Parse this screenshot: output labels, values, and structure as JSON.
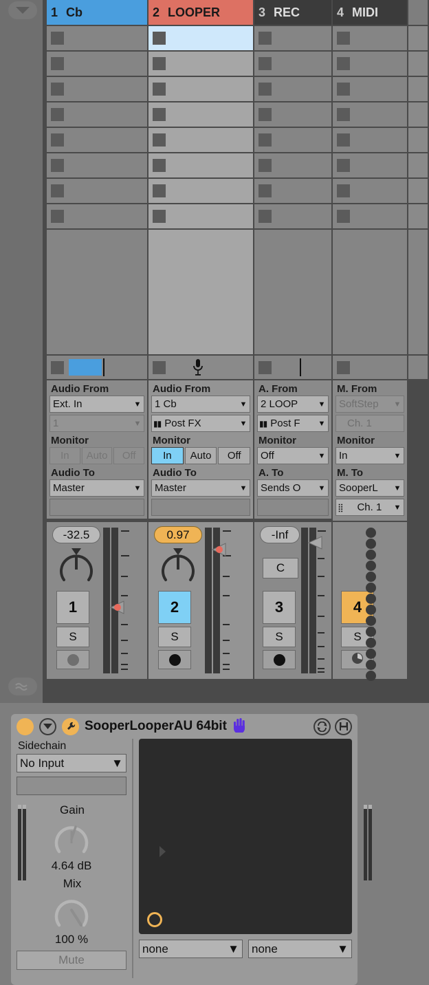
{
  "app": {
    "window_bg": "#7e7e7e",
    "accent_blue": "#4a9ede",
    "accent_amber": "#f0b455",
    "accent_red": "#dd7163"
  },
  "rail": {
    "top_icon": "chevron-down-icon",
    "bottom_icon": "waveform-icon"
  },
  "tracks": [
    {
      "num": "1",
      "name": "Cb",
      "header_color": "blue",
      "audio_from_label": "Audio From",
      "input_type": "Ext. In",
      "input_channel": "1",
      "input_channel_dim": true,
      "monitor_label": "Monitor",
      "monitor_buttons": [
        {
          "label": "In",
          "state": "off"
        },
        {
          "label": "Auto",
          "state": "off"
        },
        {
          "label": "Off",
          "state": "off"
        }
      ],
      "audio_to_label": "Audio To",
      "output": "Master",
      "output_channel": "",
      "volume": "-32.5",
      "volume_style": "plain",
      "track_button": "1",
      "solo": "S",
      "arm_active": false,
      "has_bluebar": true,
      "has_playcursor": true,
      "has_mic": false,
      "pan_indicator": true
    },
    {
      "num": "2",
      "name": "LOOPER",
      "header_color": "red",
      "audio_from_label": "Audio From",
      "input_type": "1   Cb",
      "input_channel": "Post FX",
      "input_channel_dim": false,
      "monitor_label": "Monitor",
      "monitor_buttons": [
        {
          "label": "In",
          "state": "active"
        },
        {
          "label": "Auto",
          "state": "on"
        },
        {
          "label": "Off",
          "state": "on"
        }
      ],
      "audio_to_label": "Audio To",
      "output": "Master",
      "output_channel": "",
      "volume": "0.97",
      "volume_style": "amber",
      "track_button": "2",
      "solo": "S",
      "arm_active": true,
      "has_bluebar": false,
      "has_playcursor": false,
      "has_mic": true,
      "pan_indicator": true,
      "selected": true
    },
    {
      "num": "3",
      "name": "REC",
      "header_color": "dark",
      "audio_from_label": "A. From",
      "input_type": "2   LOOP",
      "input_channel": "Post F",
      "input_channel_dim": false,
      "monitor_label": "Monitor",
      "monitor_dropdown": "Off",
      "audio_to_label": "A. To",
      "output": "Sends O",
      "output_channel": "",
      "volume": "-Inf",
      "volume_style": "plain",
      "pan_value": "C",
      "track_button": "3",
      "solo": "S",
      "arm_active": true,
      "has_bluebar": false,
      "has_playcursor": true,
      "has_mic": false
    },
    {
      "num": "4",
      "name": "MIDI",
      "header_color": "dark",
      "audio_from_label": "M. From",
      "input_type": "SoftStep",
      "input_channel": "Ch. 1",
      "input_channel_dim": true,
      "input_type_dim": true,
      "monitor_label": "Monitor",
      "monitor_dropdown": "In",
      "audio_to_label": "M. To",
      "output": "SooperL",
      "output_channel": "Ch. 1",
      "track_button": "4",
      "solo": "S",
      "arm_active": false,
      "has_bluebar": false,
      "has_playcursor": false,
      "has_mic": false,
      "send_dot_count": 14
    }
  ],
  "clip_rows": 8,
  "device": {
    "title": "SooperLooperAU 64bit",
    "power_icon": "power-led-icon",
    "fold_icon": "chevron-down-icon",
    "wrench_icon": "wrench-icon",
    "hand_icon": "hand-icon",
    "hotswap_icon": "hot-swap-icon",
    "save_icon": "save-preset-icon",
    "sidechain_label": "Sidechain",
    "sidechain_value": "No Input",
    "sidechain_sub": "",
    "gain_label": "Gain",
    "gain_value": "4.64 dB",
    "mix_label": "Mix",
    "mix_value": "100 %",
    "mute_label": "Mute",
    "screen_dropdown_left": "none",
    "screen_dropdown_right": "none",
    "expand_arrow_icon": "triangle-right-icon"
  }
}
